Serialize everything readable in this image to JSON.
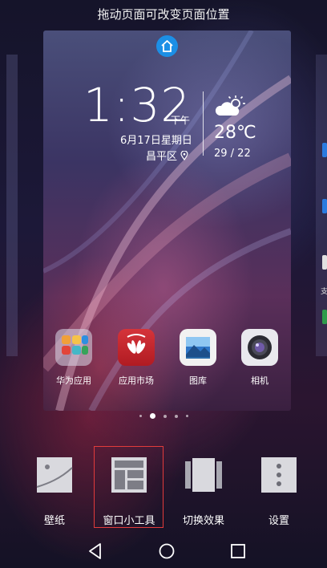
{
  "header": {
    "hint": "拖动页面可改变页面位置"
  },
  "side_right": {
    "text": "支"
  },
  "clock": {
    "time": "1:32",
    "ampm": "下午",
    "date": "6月17日星期日",
    "location": "昌平区"
  },
  "weather": {
    "temp": "28℃",
    "range": "29 / 22"
  },
  "apps": [
    {
      "label": "华为应用",
      "icon": "folder-icon"
    },
    {
      "label": "应用市场",
      "icon": "huawei-appmarket-icon"
    },
    {
      "label": "图库",
      "icon": "gallery-icon"
    },
    {
      "label": "相机",
      "icon": "camera-icon"
    }
  ],
  "toolbar": [
    {
      "label": "壁纸",
      "icon": "wallpaper-icon"
    },
    {
      "label": "窗口小工具",
      "icon": "widgets-icon"
    },
    {
      "label": "切换效果",
      "icon": "transition-effects-icon"
    },
    {
      "label": "设置",
      "icon": "settings-icon"
    }
  ],
  "colors": {
    "accent_blue": "#1c8fe6",
    "selection_red": "#e23b3b"
  }
}
